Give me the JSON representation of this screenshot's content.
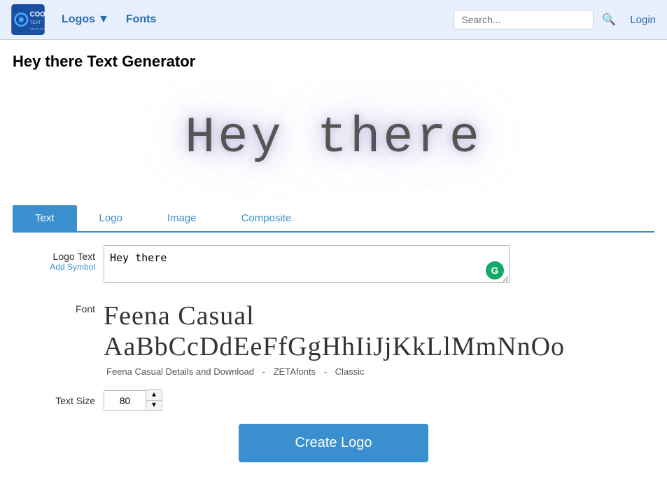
{
  "header": {
    "logo_alt": "CoolText Graphics Generator",
    "logo_main": "COOLTEXT",
    "logo_sub": "GRAPHICS GENERATOR",
    "nav_logos": "Logos",
    "nav_logos_arrow": "▼",
    "nav_fonts": "Fonts",
    "search_placeholder": "Search...",
    "search_icon": "🔍",
    "login_label": "Login"
  },
  "page": {
    "title": "Hey there Text Generator"
  },
  "preview": {
    "text": "Hey there"
  },
  "tabs": [
    {
      "id": "text",
      "label": "Text",
      "active": true
    },
    {
      "id": "logo",
      "label": "Logo",
      "active": false
    },
    {
      "id": "image",
      "label": "Image",
      "active": false
    },
    {
      "id": "composite",
      "label": "Composite",
      "active": false
    }
  ],
  "form": {
    "logo_text_label": "Logo Text",
    "add_symbol_label": "Add Symbol",
    "logo_text_value": "Hey there",
    "grammarly_letter": "G",
    "font_label": "Font",
    "font_display": "Feena Casual AaBbCcDdEeFfGgHhIiJjKkLlMmNnOo",
    "font_detail_link": "Feena Casual Details and Download",
    "font_sep1": "-",
    "font_link2": "ZETAfonts",
    "font_sep2": "-",
    "font_link3": "Classic",
    "text_size_label": "Text Size",
    "text_size_value": "80",
    "spinner_up": "▲",
    "spinner_down": "▼",
    "create_logo_label": "Create Logo"
  }
}
